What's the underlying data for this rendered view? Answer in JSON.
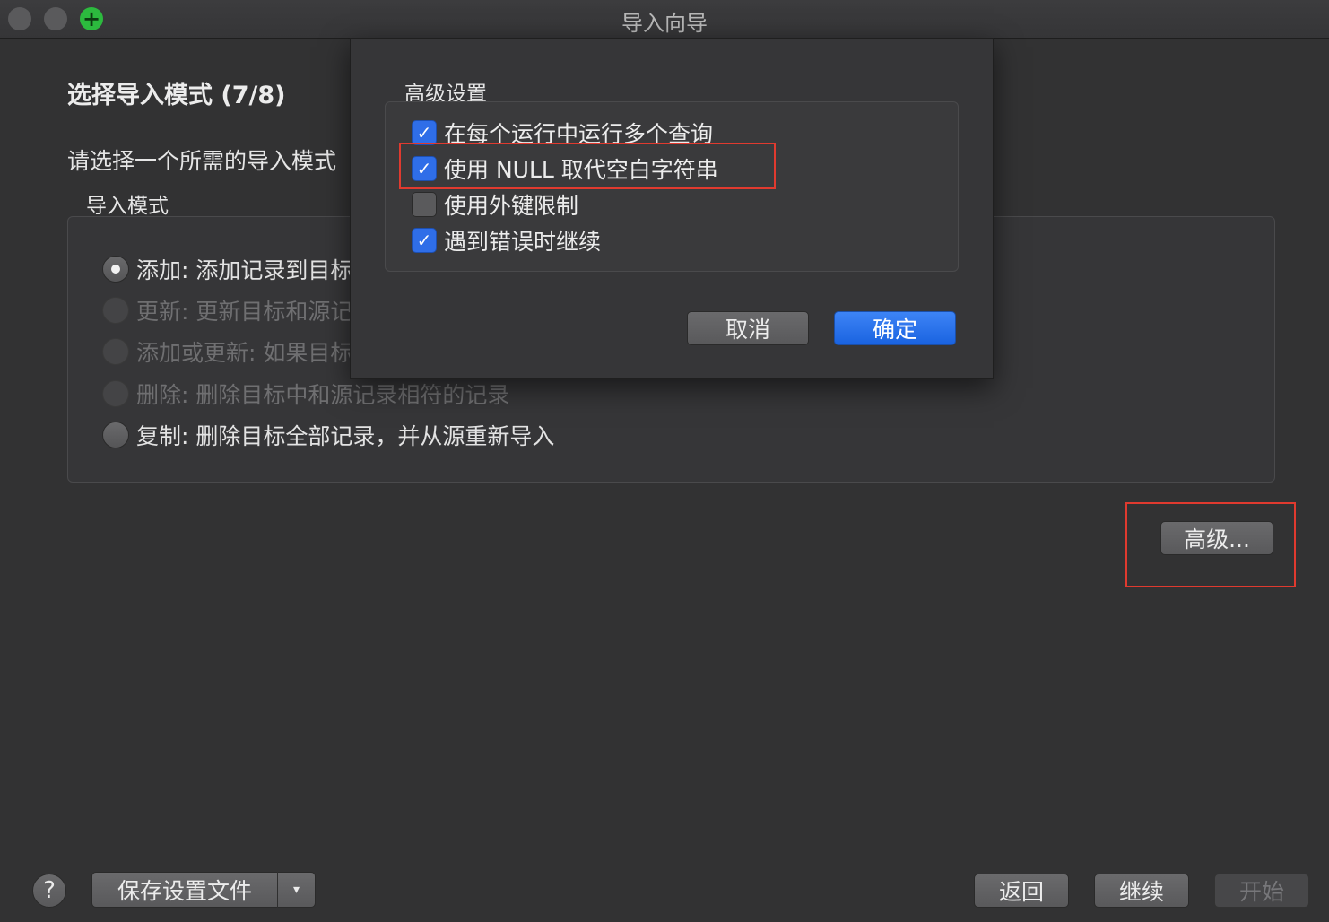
{
  "window": {
    "title": "导入向导"
  },
  "wizard": {
    "step_title": "选择导入模式 (7/8)",
    "instruction": "请选择一个所需的导入模式",
    "group_label": "导入模式",
    "modes": [
      {
        "label": "添加: 添加记录到目标",
        "selected": true,
        "enabled": true
      },
      {
        "label": "更新: 更新目标和源记",
        "selected": false,
        "enabled": false
      },
      {
        "label": "添加或更新: 如果目标",
        "selected": false,
        "enabled": false
      },
      {
        "label": "删除: 删除目标中和源记录相符的记录",
        "selected": false,
        "enabled": false
      },
      {
        "label": "复制: 删除目标全部记录，并从源重新导入",
        "selected": false,
        "enabled": true
      }
    ],
    "advanced_button": "高级..."
  },
  "dialog": {
    "group_label": "高级设置",
    "options": [
      {
        "label": "在每个运行中运行多个查询",
        "checked": true
      },
      {
        "label": "使用 NULL 取代空白字符串",
        "checked": true
      },
      {
        "label": "使用外键限制",
        "checked": false
      },
      {
        "label": "遇到错误时继续",
        "checked": true
      }
    ],
    "cancel": "取消",
    "ok": "确定"
  },
  "footer": {
    "help": "?",
    "save_profile": "保存设置文件",
    "dropdown_arrow": "▾",
    "back": "返回",
    "continue": "继续",
    "start": "开始"
  },
  "colors": {
    "highlight": "#e03a2f",
    "accent": "#2f6ee8"
  },
  "icons": {
    "check": "✓",
    "plus": "+"
  }
}
